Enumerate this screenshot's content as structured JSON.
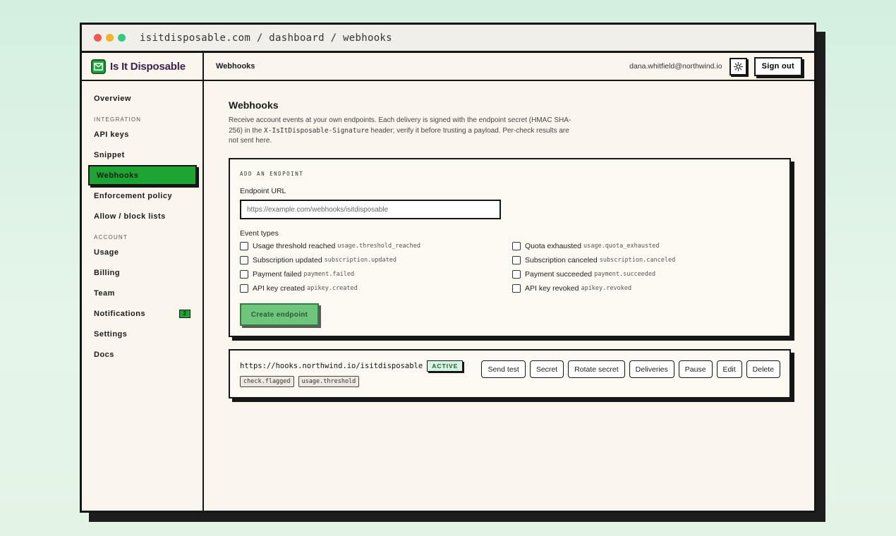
{
  "browser": {
    "address": "isitdisposable.com / dashboard / webhooks"
  },
  "brand": {
    "name": "Is It Disposable"
  },
  "sidebar": {
    "items": [
      {
        "label": "Overview",
        "type": "item"
      },
      {
        "label": "INTEGRATION",
        "type": "section"
      },
      {
        "label": "API keys",
        "type": "item"
      },
      {
        "label": "Snippet",
        "type": "item"
      },
      {
        "label": "Webhooks",
        "type": "item",
        "active": true
      },
      {
        "label": "Enforcement policy",
        "type": "item"
      },
      {
        "label": "Allow / block lists",
        "type": "item"
      },
      {
        "label": "ACCOUNT",
        "type": "section"
      },
      {
        "label": "Usage",
        "type": "item"
      },
      {
        "label": "Billing",
        "type": "item"
      },
      {
        "label": "Team",
        "type": "item"
      },
      {
        "label": "Notifications",
        "type": "item",
        "badge": "2"
      },
      {
        "label": "Settings",
        "type": "item"
      },
      {
        "label": "Docs",
        "type": "item"
      }
    ]
  },
  "topbar": {
    "title": "Webhooks",
    "email": "dana.whitfield@northwind.io",
    "theme_icon": "sun-icon",
    "signout_label": "Sign out"
  },
  "main": {
    "title": "Webhooks",
    "desc_pre": "Receive account events at your own endpoints. Each delivery is signed with the endpoint secret (HMAC SHA-256) in the ",
    "desc_code": "X-IsItDisposable-Signature",
    "desc_post": " header; verify it before trusting a payload. Per-check results are not sent here."
  },
  "add_endpoint": {
    "card_label": "ADD AN ENDPOINT",
    "url_label": "Endpoint URL",
    "url_placeholder": "https://example.com/webhooks/isitdisposable",
    "url_value": "",
    "types_label": "Event types",
    "event_types": [
      {
        "label": "Usage threshold reached",
        "code": "usage.threshold_reached",
        "checked": false
      },
      {
        "label": "Quota exhausted",
        "code": "usage.quota_exhausted",
        "checked": false
      },
      {
        "label": "Subscription updated",
        "code": "subscription.updated",
        "checked": false
      },
      {
        "label": "Subscription canceled",
        "code": "subscription.canceled",
        "checked": false
      },
      {
        "label": "Payment failed",
        "code": "payment.failed",
        "checked": false
      },
      {
        "label": "Payment succeeded",
        "code": "payment.succeeded",
        "checked": false
      },
      {
        "label": "API key created",
        "code": "apikey.created",
        "checked": false
      },
      {
        "label": "API key revoked",
        "code": "apikey.revoked",
        "checked": false
      }
    ],
    "create_label": "Create endpoint"
  },
  "endpoint": {
    "url": "https://hooks.northwind.io/isitdisposable",
    "status": "ACTIVE",
    "tags": [
      "check.flagged",
      "usage.threshold"
    ],
    "actions": [
      "Send test",
      "Secret",
      "Rotate secret",
      "Deliveries",
      "Pause",
      "Edit",
      "Delete"
    ]
  },
  "colors": {
    "accent": "#1ca532",
    "brand_text": "#3c1e4d",
    "background": "#faf6ee"
  }
}
